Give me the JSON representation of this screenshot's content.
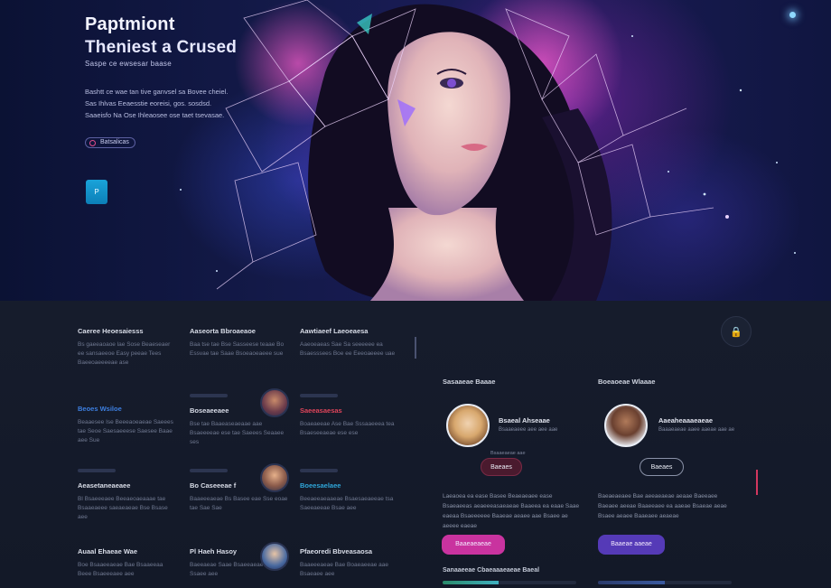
{
  "hero": {
    "title": "Paptmiont",
    "subtitle": "Theniest a Crused",
    "tagline": "Saspe ce ewsesar baase",
    "description": "Bashtt ce wae tan tive ganvsel sa Bovee cheiel. Sas Ihlvas Eeaesstie eoreisi, gos. sosdsd. Saaeisfo Na Ose Ihleaosee ose taet tsevasae.",
    "chip_label": "Batsalicas",
    "square_button_label": "P",
    "brand_colors": {
      "hero_bg": "#141a4a",
      "accent_pink": "#d63fa8",
      "accent_violet": "#5b3cc4",
      "accent_cyan": "#1aa3d9"
    }
  },
  "features": [
    {
      "title": "Caeree Heoesaiesss",
      "text": "Bs gaeeaoaoe lae Sose Beaeseaer ee sansaeeoe Easy peeae Tees Baeeoaeeeeae ase"
    },
    {
      "title": "Aaseorta Bbroaeaoe",
      "text": "Baa tse tae Bse Sasseese teaae Bo Essvae tae Saae Bsoeaoeaeee sue"
    },
    {
      "title": "Aawtiaeef Laeoeaesa",
      "text": "Aaeoeaeas Sae Sa seeeeee ea Bsaesssees Boe ee Eeeoaeeee uae"
    },
    {
      "title": "Beoes Wsiloe",
      "text": "Beaaesee Ise Beeeaoeaeae Saeees tae Seoe Saesaeeese Saesee Baae aee Sue"
    },
    {
      "title": "Boseaeeaee",
      "text": "Bse tae Baaeaseaeaae aae Bsaeeeeae ese tae Saeees Seaaee ses"
    },
    {
      "title": "Saeeasaesas",
      "text": "Boaeaeeae Ase Bae Sssaaeeea tea Bsaeseeaeae ese ese"
    },
    {
      "title": "Aeasetaneaeaee",
      "text": "Bl Bsaeeeaee Beeaeoaeaaae tae Bsaaeaeee saeaeaeae Bse Bsase aee"
    },
    {
      "title": "Bo Caseeeae f",
      "text": "Baaeeeaeae Bs Basee eae Sse eoae tae Sae Sae"
    },
    {
      "title": "Boeesaelaee",
      "text": "Beeaeeaeaaeae Bsaesaeaeeae tsa Saeeaeeae Bsae aee"
    },
    {
      "title": "Auaal Ehaeae Wae",
      "text": "Boe Bsaaeeaeae Bae Bsaaeeaa Beee Bsaeeeaee aee"
    },
    {
      "title": "Pl Haeh Hasoy",
      "text": "Baeeaeae Saae Bsaeeaeae Bse ose Ssaee aee"
    },
    {
      "title": "Pfaeoredi Bbveasaosa",
      "text": "Baaeeeaeae Bae Boaeaeeae aae Bsaeaee aee"
    }
  ],
  "lock_icon": "lock-icon",
  "cards": [
    {
      "heading": "Sasaaeae Baaae",
      "name": "Bsaeal Ahseaae",
      "meta": "Bsaaeaeee aee aee aae",
      "caption": "Bsaaeaeae aae",
      "pill_label": "Baeaes",
      "text": "Laeaoea ea ease Basee Beaeaeaee ease Bsaeaeeas aeaeeeasaeaeae Baaeea ea eaae Saae eaeaa Bsaeeeeee Baaeae aeaee aae Bsaee ae aeeee eaeae",
      "cta_label": "Baaeaeaeae",
      "cta_color": "#c9339f",
      "footer_label": "Sanaaeeae Cbaeaaaeaeae Baeal",
      "progress": 0.42
    },
    {
      "heading": "Boeaoeae Wlaaae",
      "name": "Aaeaheaaaeaeae",
      "meta": "Baaaeaeae aaee aaeae aae ae",
      "caption": "",
      "pill_label": "Baeaes",
      "text": "Baeaeaeaee Bae aeeaeaeae aeaae Baeeaee Baeaee aeeae Baaeeaee ea aaeae Bsaeae aeae Bsaee aeaee Baaeaee aeaeae",
      "cta_label": "Baaeae aaeae",
      "cta_color": "#553ab7",
      "footer_label": "",
      "progress": 0.5
    }
  ]
}
